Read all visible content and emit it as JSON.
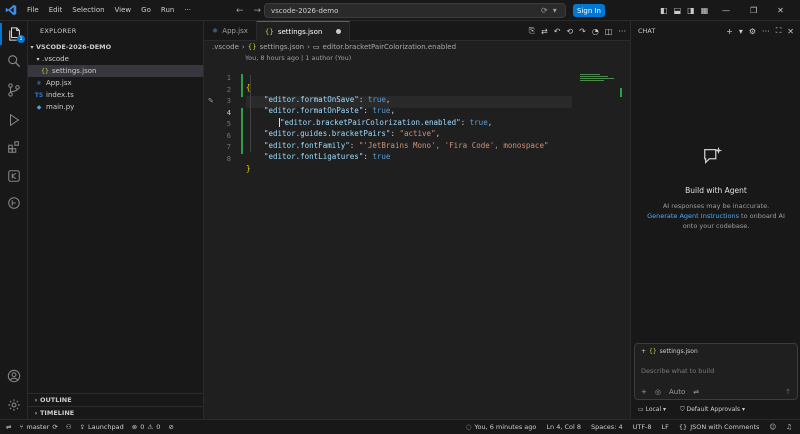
{
  "titlebar": {
    "menus": [
      "File",
      "Edit",
      "Selection",
      "View",
      "Go",
      "Run",
      "···"
    ],
    "search_value": "vscode-2026-demo",
    "signin_label": "Sign In"
  },
  "explorer": {
    "title": "EXPLORER",
    "project": "VSCODE-2026-DEMO",
    "folder": ".vscode",
    "files": {
      "settings": "settings.json",
      "app": "App.jsx",
      "index": "index.ts",
      "main": "main.py"
    },
    "outline": "OUTLINE",
    "timeline": "TIMELINE"
  },
  "editor": {
    "tabs": [
      {
        "label": "App.jsx",
        "icon": "react-icon"
      },
      {
        "label": "settings.json",
        "icon": "json-icon"
      }
    ],
    "breadcrumb": [
      ".vscode",
      "settings.json",
      "editor.bracketPairColorization.enabled"
    ],
    "blame": "You, 8 hours ago | 1 author (You)",
    "line_numbers": [
      "1",
      "2",
      "3",
      "4",
      "5",
      "6",
      "7",
      "8"
    ],
    "lines": [
      {
        "key": "",
        "val": ""
      },
      {
        "key": "\"editor.formatOnSave\"",
        "val": "true"
      },
      {
        "key": "\"editor.formatOnPaste\"",
        "val": "true"
      },
      {
        "key": "\"editor.bracketPairColorization.enabled\"",
        "val": "true"
      },
      {
        "key": "\"editor.guides.bracketPairs\"",
        "val": "\"active\""
      },
      {
        "key": "\"editor.fontFamily\"",
        "val": "\"'JetBrains Mono', 'Fira Code', monospace\""
      },
      {
        "key": "\"editor.fontLigatures\"",
        "val": "true"
      },
      {
        "key": "",
        "val": ""
      }
    ]
  },
  "chat": {
    "title": "CHAT",
    "agent_title": "Build with Agent",
    "agent_desc_1": "AI responses may be inaccurate.",
    "agent_link": "Generate Agent Instructions",
    "agent_desc_2": " to onboard AI onto your codebase.",
    "context_file": "settings.json",
    "input_placeholder": "Describe what to build",
    "mode": "Auto",
    "footer_local": "Local",
    "footer_approvals": "Default Approvals"
  },
  "status": {
    "branch": "master",
    "launchpad": "Launchpad",
    "errors": "0",
    "warnings": "0",
    "blame": "You, 6 minutes ago",
    "position": "Ln 4, Col 8",
    "spaces": "Spaces: 4",
    "encoding": "UTF-8",
    "eol": "LF",
    "language": "JSON with Comments"
  },
  "colors": {
    "accent": "#0078d4",
    "json_key": "#9cdcfe",
    "json_string": "#ce9178",
    "json_bool": "#569cd6",
    "bracket": "#ffd700"
  }
}
